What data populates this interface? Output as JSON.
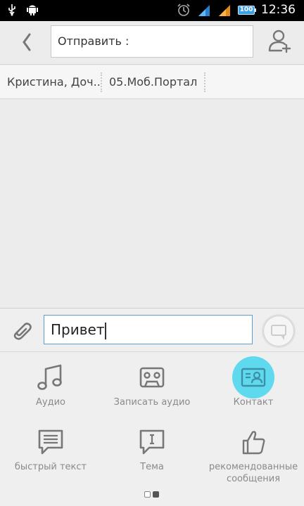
{
  "status_bar": {
    "time": "12:36",
    "battery": "100",
    "icons": [
      "usb-icon",
      "android-debug-icon",
      "alarm-icon",
      "wifi-signal-icon",
      "cell-signal-icon",
      "battery-icon"
    ]
  },
  "header": {
    "to_field": "Отправить :",
    "back_icon": "chevron-left-icon",
    "add_contact_icon": "add-contact-icon"
  },
  "recipients": [
    "Кристина, Доч...",
    "05.Моб.Портал"
  ],
  "compose": {
    "message": "Привет",
    "attach_icon": "paperclip-icon",
    "send_icon": "send-message-icon"
  },
  "attachments": [
    {
      "label": "Аудио",
      "icon": "music-note-icon"
    },
    {
      "label": "Записать аудио",
      "icon": "cassette-icon"
    },
    {
      "label": "Контакт",
      "icon": "contact-card-icon"
    },
    {
      "label": "быстрый текст",
      "icon": "quick-text-icon"
    },
    {
      "label": "Тема",
      "icon": "subject-icon"
    },
    {
      "label": "рекомендованные сообщения",
      "icon": "thumbs-up-icon"
    }
  ],
  "pager": {
    "pages": 2,
    "current": 2
  },
  "colors": {
    "accent": "#5fd9ee",
    "input_border": "#5a9fd4",
    "status_bar": "#000000"
  }
}
